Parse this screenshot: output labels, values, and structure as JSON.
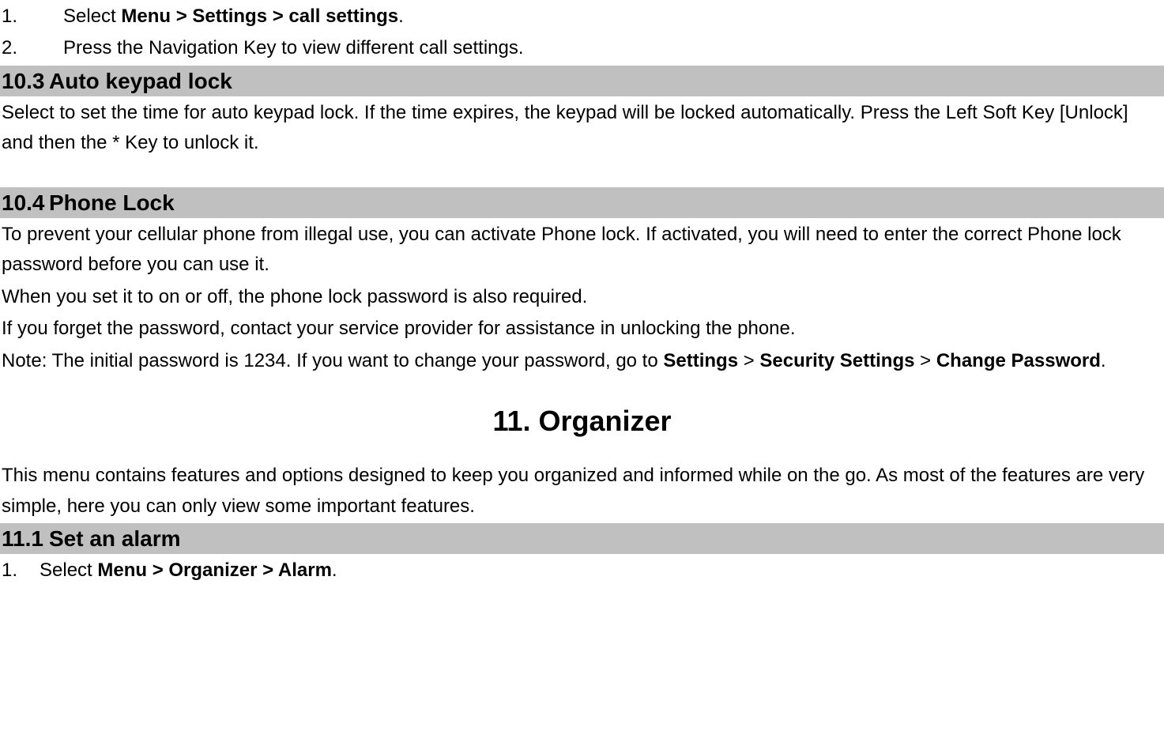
{
  "steps_top": [
    {
      "num": "1.",
      "prefix": "Select ",
      "bold": "Menu > Settings > call settings",
      "suffix": "."
    },
    {
      "num": "2.",
      "prefix": "Press the Navigation Key to view different call settings.",
      "bold": "",
      "suffix": ""
    }
  ],
  "sec103": {
    "num": "10.3",
    "title": "Auto keypad lock",
    "para": "Select to set the time for auto keypad lock. If the time expires, the keypad will be locked automatically. Press the Left Soft Key [Unlock] and then the * Key to unlock it."
  },
  "sec104": {
    "num": "10.4",
    "title": "Phone Lock",
    "p1": "To prevent your cellular phone from illegal use, you can activate Phone lock. If activated, you will need to enter the correct Phone lock password before you can use it.",
    "p2": "When you set it to on or off, the phone lock password is also required.",
    "p3": "If you forget the password, contact your service provider for assistance in unlocking the phone.",
    "note_prefix": "Note: The initial password is 1234. If you want to change your password, go to ",
    "note_b1": "Settings",
    "note_s1": " > ",
    "note_b2": "Security Settings",
    "note_s2": " > ",
    "note_b3": "Change Password",
    "note_suffix": "."
  },
  "chapter11": {
    "title": "11. Organizer",
    "intro": "This menu contains features and options designed to keep you organized and informed while on the go. As most of the features are very simple, here you can only view some important features."
  },
  "sec111": {
    "num": "11.1",
    "title": "Set an alarm",
    "step1_num": "1.",
    "step1_prefix": "Select ",
    "step1_bold": "Menu > Organizer > Alarm",
    "step1_suffix": "."
  }
}
